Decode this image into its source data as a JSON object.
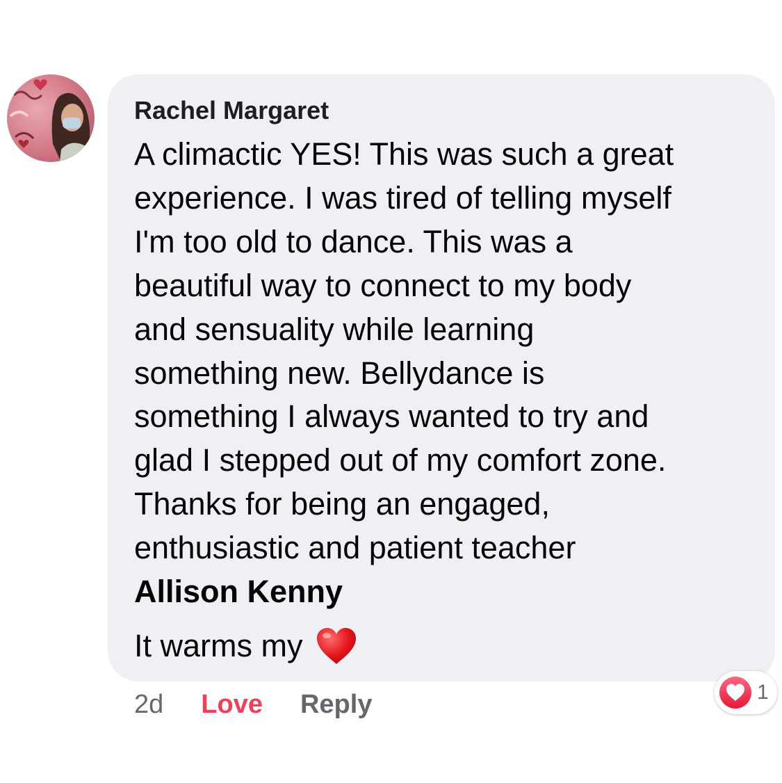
{
  "comment": {
    "author": "Rachel Margaret",
    "text": "A climactic YES! This was such a great\nexperience. I was tired of telling myself\nI'm too old to dance. This was a\nbeautiful way to connect to my body\nand sensuality while learning\nsomething new. Bellydance is\nsomething I always wanted to try and\nglad I stepped out of my comfort zone.\nThanks for being an engaged,\nenthusiastic and patient teacher",
    "mention": "Allison Kenny",
    "closing": "It warms my",
    "closing_emoji": "heart-emoji"
  },
  "actions": {
    "time": "2d",
    "love_label": "Love",
    "reply_label": "Reply"
  },
  "reactions": {
    "icon": "love-reaction-icon",
    "count": "1",
    "color": "#f33e58"
  },
  "colors": {
    "bubble": "#eff0f3",
    "love": "#f33e58",
    "secondary_text": "#65676b"
  }
}
